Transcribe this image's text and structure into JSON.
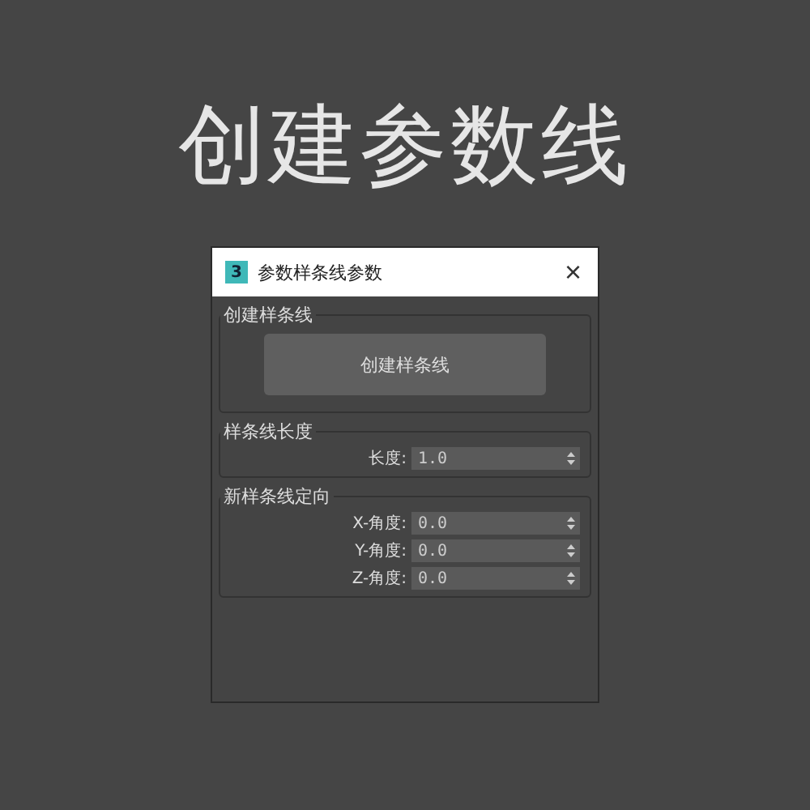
{
  "heading": "创建参数线",
  "dialog": {
    "app_badge": "3",
    "title": "参数样条线参数",
    "close": "×"
  },
  "groups": [
    {
      "title": "创建样条线",
      "kind": "button",
      "button": "创建样条线"
    },
    {
      "title": "样条线长度",
      "kind": "fields",
      "fields": [
        {
          "label": "长度:",
          "value": "1.0"
        }
      ]
    },
    {
      "title": "新样条线定向",
      "kind": "fields",
      "fields": [
        {
          "label": "X-角度:",
          "value": "0.0"
        },
        {
          "label": "Y-角度:",
          "value": "0.0"
        },
        {
          "label": "Z-角度:",
          "value": "0.0"
        }
      ]
    }
  ]
}
